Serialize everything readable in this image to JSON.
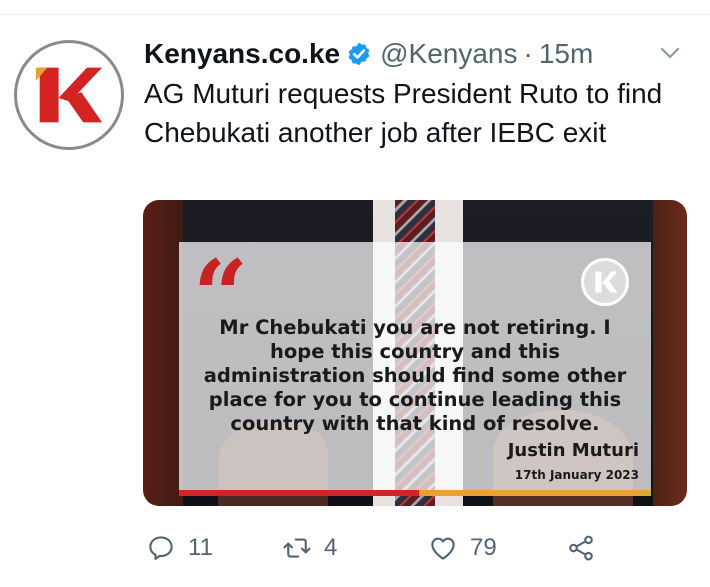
{
  "tweet": {
    "author_name": "Kenyans.co.ke",
    "handle": "@Kenyans",
    "separator": "·",
    "time": "15m",
    "text": "AG Muturi requests President Ruto to find Chebukati another job after IEBC exit"
  },
  "media": {
    "quote_mark": "“",
    "quote": "Mr Chebukati you are not retiring. I hope this country and this administration should find some other place for you to continue leading this country with that kind of resolve.",
    "author": "Justin Muturi",
    "date": "17th January 2023",
    "logo_letter": "K"
  },
  "actions": {
    "replies": "11",
    "retweets": "4",
    "likes": "79"
  },
  "icons": {
    "verified": "verified-badge-icon",
    "caret": "chevron-down-icon",
    "reply": "reply-icon",
    "retweet": "retweet-icon",
    "like": "heart-icon",
    "share": "share-icon"
  },
  "colors": {
    "brand_red": "#d32323",
    "brand_orange": "#e8a135",
    "verified_blue": "#1d9bf0",
    "secondary_text": "#536471"
  }
}
